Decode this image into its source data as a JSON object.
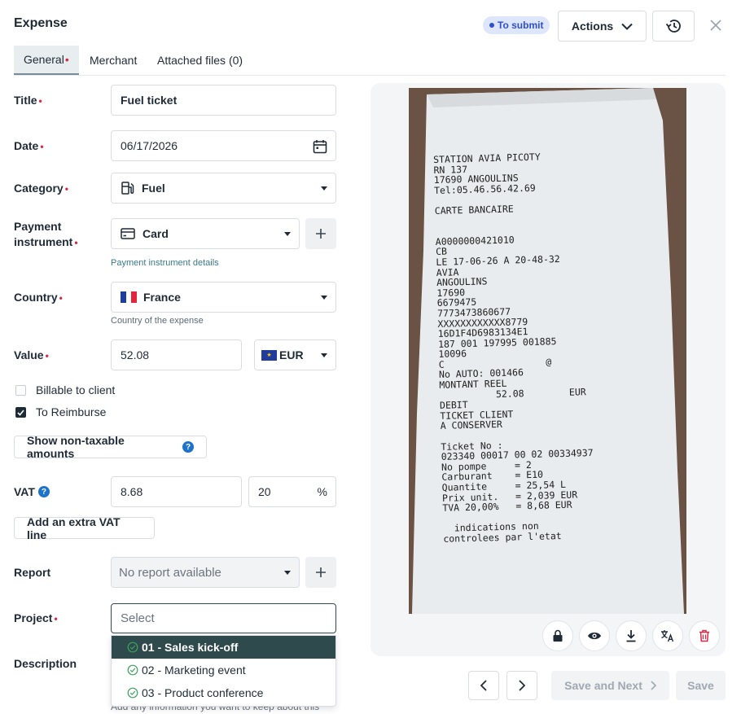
{
  "header": {
    "title": "Expense",
    "status": "To submit",
    "actions_label": "Actions"
  },
  "tabs": [
    {
      "label": "General",
      "required": true
    },
    {
      "label": "Merchant"
    },
    {
      "label": "Attached files (0)"
    }
  ],
  "form": {
    "title_label": "Title",
    "title_value": "Fuel ticket",
    "date_label": "Date",
    "date_value": "06/17/2026",
    "category_label": "Category",
    "category_value": "Fuel",
    "payment_label_1": "Payment",
    "payment_label_2": "instrument",
    "payment_value": "Card",
    "payment_hint": "Payment instrument details",
    "country_label": "Country",
    "country_value": "France",
    "country_hint": "Country of the expense",
    "value_label": "Value",
    "value_amount": "52.08",
    "currency": "EUR",
    "billable_label": "Billable to client",
    "billable_checked": false,
    "reimburse_label": "To Reimburse",
    "reimburse_checked": true,
    "non_taxable_label": "Show non-taxable amounts",
    "vat_label": "VAT",
    "vat_amount": "8.68",
    "vat_rate": "20",
    "vat_unit": "%",
    "extra_vat_label": "Add an extra VAT line",
    "report_label": "Report",
    "report_placeholder": "No report available",
    "project_label": "Project",
    "project_placeholder": "Select",
    "description_label": "Description",
    "description_hint": "Add any information you want to keep about this"
  },
  "project_options": [
    {
      "label": "01 - Sales kick-off",
      "selected": true
    },
    {
      "label": "02 - Marketing event",
      "selected": false
    },
    {
      "label": "03 - Product conference",
      "selected": false
    }
  ],
  "receipt": {
    "lines": [
      "STATION AVIA PICOTY",
      "RN 137",
      "17690 ANGOULINS",
      "Tel:05.46.56.42.69",
      "",
      "CARTE BANCAIRE",
      "",
      "",
      "A0000000421010",
      "CB",
      "LE 17-06-26 A 20-48-32",
      "AVIA",
      "ANGOULINS",
      "17690",
      "6679475",
      "7773473860677",
      "XXXXXXXXXXXX8779",
      "16D1F4D6983134E1",
      "187 001 197995 001885",
      "10096",
      "C                  @",
      "No AUTO: 001466",
      "MONTANT REEL",
      "          52.08        EUR",
      "DEBIT",
      "TICKET CLIENT",
      "A CONSERVER",
      "",
      "Ticket No :",
      "023340 00017 00 02 00334937",
      "No pompe     = 2",
      "Carburant    = E10",
      "Quantite     = 25,54 L",
      "Prix unit.   = 2,039 EUR",
      "TVA 20,00%   = 8,68 EUR",
      "",
      "  indications non",
      "controlees par l'etat"
    ]
  },
  "footer": {
    "save_next_label": "Save and Next",
    "save_label": "Save"
  },
  "colors": {
    "required": "#d62b45",
    "status_bg": "#dde6fb",
    "status_text": "#2f4fd0",
    "selected_option_bg": "#2f4a4c",
    "help_icon": "#1d72c9"
  }
}
